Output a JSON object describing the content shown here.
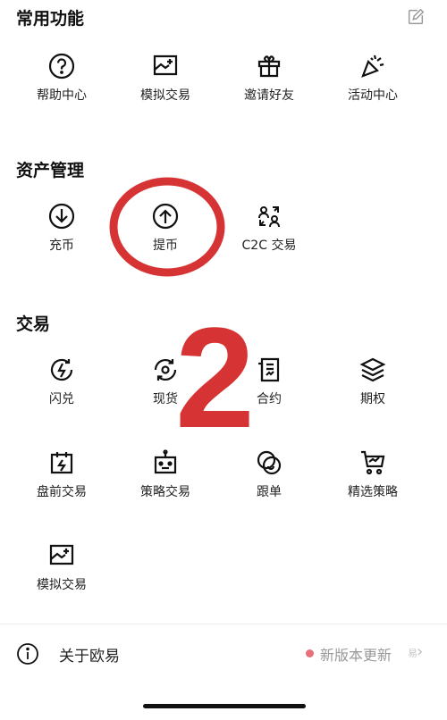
{
  "sections": {
    "common": {
      "title": "常用功能",
      "items": [
        {
          "label": "帮助中心",
          "icon": "help-circle-icon"
        },
        {
          "label": "模拟交易",
          "icon": "simulated-trading-icon"
        },
        {
          "label": "邀请好友",
          "icon": "gift-icon"
        },
        {
          "label": "活动中心",
          "icon": "party-popper-icon"
        }
      ]
    },
    "assets": {
      "title": "资产管理",
      "items": [
        {
          "label": "充币",
          "icon": "deposit-icon"
        },
        {
          "label": "提币",
          "icon": "withdraw-icon"
        },
        {
          "label": "C2C 交易",
          "icon": "c2c-icon"
        }
      ]
    },
    "trade": {
      "title": "交易",
      "items": [
        {
          "label": "闪兑",
          "icon": "flash-convert-icon"
        },
        {
          "label": "现货",
          "icon": "spot-icon"
        },
        {
          "label": "合约",
          "icon": "contract-icon"
        },
        {
          "label": "期权",
          "icon": "options-layers-icon"
        },
        {
          "label": "盘前交易",
          "icon": "pre-market-icon"
        },
        {
          "label": "策略交易",
          "icon": "robot-icon"
        },
        {
          "label": "跟单",
          "icon": "copy-trade-icon"
        },
        {
          "label": "精选策略",
          "icon": "featured-strategy-icon"
        },
        {
          "label": "模拟交易",
          "icon": "simulated-trading-icon"
        }
      ]
    }
  },
  "bottom": {
    "about_label": "关于欧易",
    "update_label": "新版本更新",
    "chevron": "›",
    "watermark": "易"
  },
  "annotation": {
    "number": "2",
    "color": "#d63434"
  },
  "colors": {
    "icon": "#111111",
    "update_dot": "#e8707a"
  }
}
